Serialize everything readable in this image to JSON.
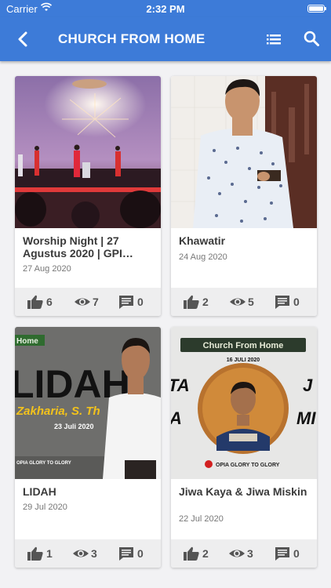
{
  "status_bar": {
    "carrier": "Carrier",
    "time": "2:32 PM"
  },
  "app_bar": {
    "title": "CHURCH FROM HOME"
  },
  "cards": [
    {
      "title": "Worship Night | 27 Agustus 2020 | GPI…",
      "date": "27 Aug 2020",
      "likes": "6",
      "views": "7",
      "comments": "0"
    },
    {
      "title": "Khawatir",
      "date": "24 Aug 2020",
      "likes": "2",
      "views": "5",
      "comments": "0"
    },
    {
      "title": "LIDAH",
      "date": "29 Jul 2020",
      "likes": "1",
      "views": "3",
      "comments": "0",
      "thumb_text": {
        "tag": "Home",
        "word": "LIDAH",
        "name": "Zakharia, S. Th",
        "date": "23 Juli 2020",
        "footer": "OPIA GLORY TO GLORY"
      }
    },
    {
      "title": "Jiwa Kaya & Jiwa Miskin",
      "date": "22 Jul 2020",
      "likes": "2",
      "views": "3",
      "comments": "0",
      "thumb_text": {
        "banner": "Church From Home",
        "date": "16 JULI 2020",
        "footer": "OPIA GLORY TO GLORY",
        "left1": "TA",
        "left2": "A",
        "right1": "J",
        "right2": "MI"
      }
    }
  ],
  "colors": {
    "primary": "#3d7bd8",
    "card_stats_bg": "#eeeeef",
    "background": "#f2f2f4"
  },
  "icons": {
    "back": "back-arrow-icon",
    "list": "list-icon",
    "search": "search-icon",
    "like": "thumb-up-icon",
    "view": "eye-icon",
    "comment": "comment-icon"
  }
}
